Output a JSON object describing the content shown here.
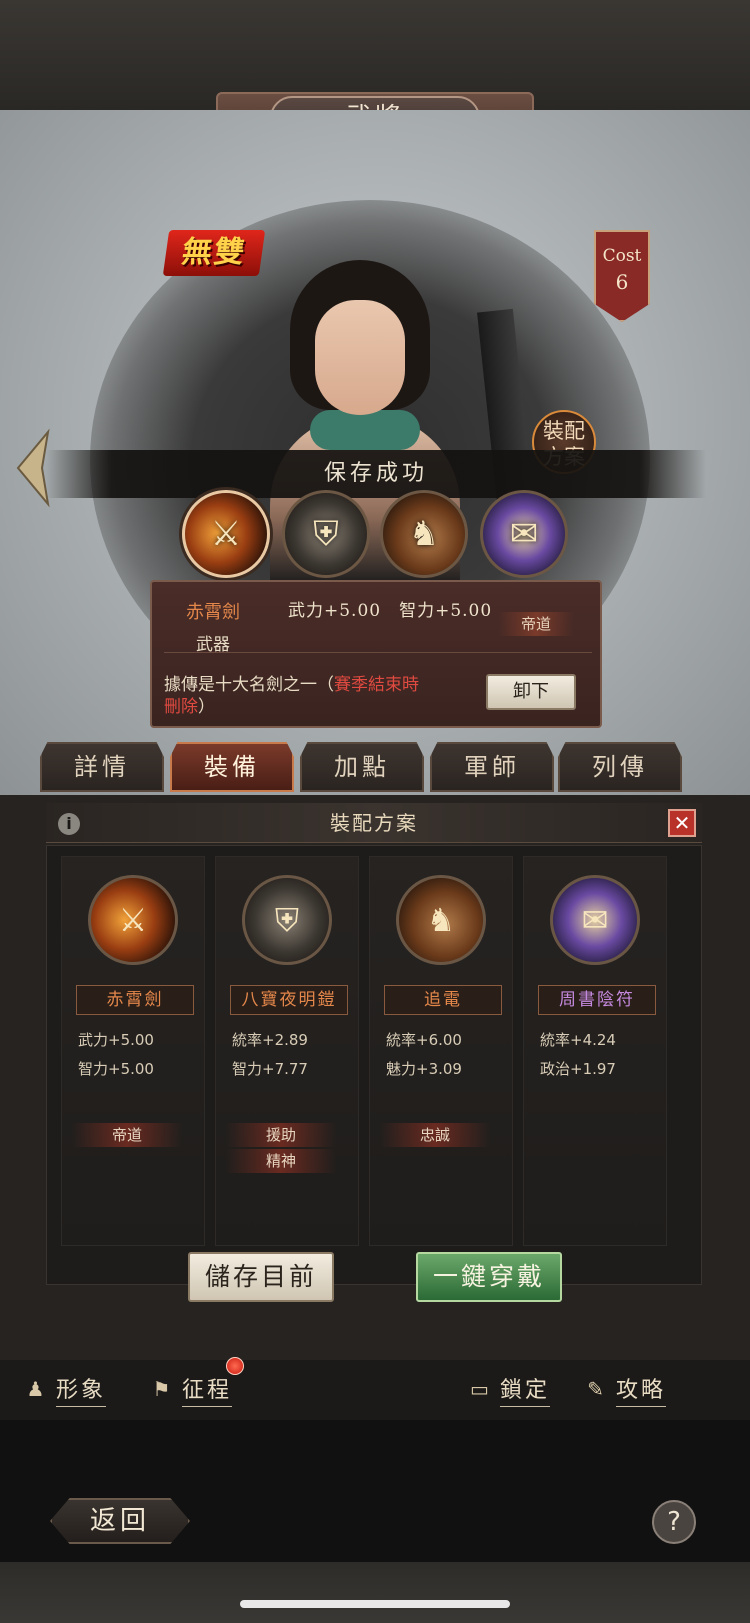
{
  "header": {
    "title": "武將"
  },
  "hero": {
    "musou_badge": "無雙",
    "cost_label": "Cost",
    "cost_value": "6",
    "loadout_badge": "裝配方案"
  },
  "toast": "保存成功",
  "slots": [
    {
      "name": "sword-slot",
      "icon": "sword-icon"
    },
    {
      "name": "armor-slot",
      "icon": "armor-icon"
    },
    {
      "name": "horse-slot",
      "icon": "horse-icon"
    },
    {
      "name": "scroll-slot",
      "icon": "scroll-icon"
    }
  ],
  "tooltip": {
    "item_name": "赤霄劍",
    "item_type": "武器",
    "stats": "武力+5.00　智力+5.00",
    "tag": "帝道",
    "desc_prefix": "據傳是十大名劍之一（",
    "desc_red": "賽季結束時",
    "desc_red2": "刪除",
    "desc_suffix": "）",
    "unequip_label": "卸下"
  },
  "tabs": [
    "詳情",
    "裝備",
    "加點",
    "軍師",
    "列傳"
  ],
  "active_tab": "裝備",
  "loadout_panel": {
    "title": "裝配方案",
    "info_icon": "i",
    "close_icon": "✕",
    "columns": [
      {
        "name": "赤霄劍",
        "name_color": "#e3874a",
        "stats": [
          "武力+5.00",
          "智力+5.00"
        ],
        "skills": [
          "帝道"
        ]
      },
      {
        "name": "八寶夜明鎧",
        "name_color": "#e3874a",
        "stats": [
          "統率+2.89",
          "智力+7.77"
        ],
        "skills": [
          "援助",
          "精神"
        ]
      },
      {
        "name": "追電",
        "name_color": "#e3874a",
        "stats": [
          "統率+6.00",
          "魅力+3.09"
        ],
        "skills": [
          "忠誠"
        ]
      },
      {
        "name": "周書陰符",
        "name_color": "#c58ae0",
        "stats": [
          "統率+4.24",
          "政治+1.97"
        ],
        "skills": []
      }
    ],
    "save_label": "儲存目前",
    "equip_label": "一鍵穿戴"
  },
  "bottom_bar": {
    "appearance": "形象",
    "campaign": "征程",
    "lock": "鎖定",
    "guide": "攻略"
  },
  "footer": {
    "back_label": "返回",
    "help_label": "?"
  }
}
